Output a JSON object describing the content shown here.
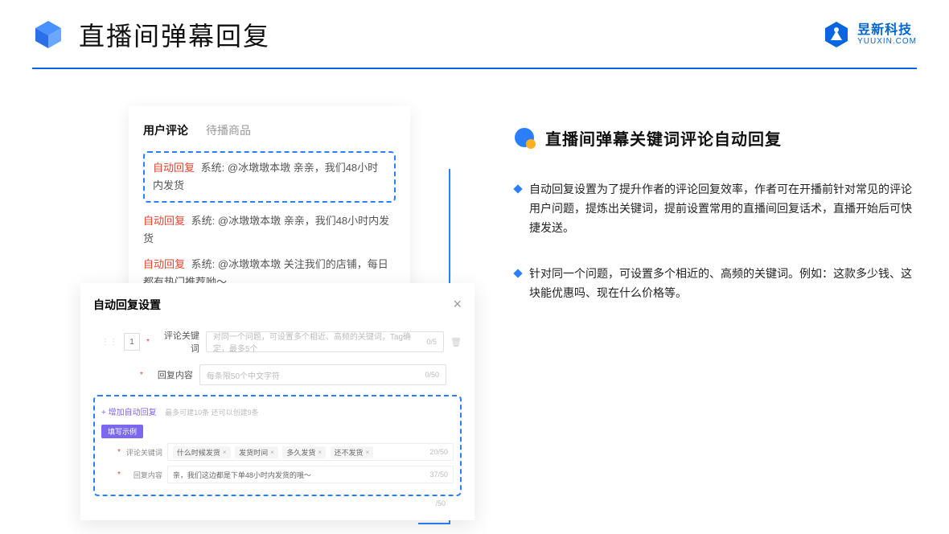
{
  "header": {
    "title": "直播间弹幕回复"
  },
  "brand": {
    "name": "昱新科技",
    "url": "YUUXIN.COM"
  },
  "section": {
    "title": "直播间弹幕关键词评论自动回复"
  },
  "bullets": [
    "自动回复设置为了提升作者的评论回复效率，作者可在开播前针对常见的评论用户问题，提炼出关键词，提前设置常用的直播间回复话术，直播开始后可快捷发送。",
    "针对同一个问题，可设置多个相近的、高频的关键词。例如：这款多少钱、这块能优惠吗、现在什么价格等。"
  ],
  "comments": {
    "tabs": {
      "active": "用户评论",
      "inactive": "待播商品"
    },
    "items": [
      {
        "tag": "自动回复",
        "prefix": "系统:",
        "text": "@冰墩墩本墩 亲亲，我们48小时内发货"
      },
      {
        "tag": "自动回复",
        "prefix": "系统:",
        "text": "@冰墩墩本墩 亲亲，我们48小时内发货"
      },
      {
        "tag": "自动回复",
        "prefix": "系统:",
        "text": "@冰墩墩本墩 关注我们的店铺，每日都有热门推荐呦～"
      }
    ]
  },
  "settings": {
    "title": "自动回复设置",
    "idx": "1",
    "row1": {
      "label": "评论关键词",
      "placeholder": "对同一个问题，可设置多个相近、高频的关键词，Tag确定，最多5个",
      "counter": "0/5"
    },
    "row2": {
      "label": "回复内容",
      "placeholder": "每条限50个中文字符",
      "counter": "0/50"
    },
    "add": "+ 增加自动回复",
    "hint": "最多可建10条 还可以创建9条",
    "example_badge": "填写示例",
    "ex1": {
      "label": "评论关键词",
      "tags": [
        "什么时候发货",
        "发货时间",
        "多久发货",
        "还不发货"
      ],
      "counter": "20/50"
    },
    "ex2": {
      "label": "回复内容",
      "text": "亲，我们这边都是下单48小时内发货的哦～",
      "counter": "37/50"
    },
    "bottom_counter": "/50"
  }
}
